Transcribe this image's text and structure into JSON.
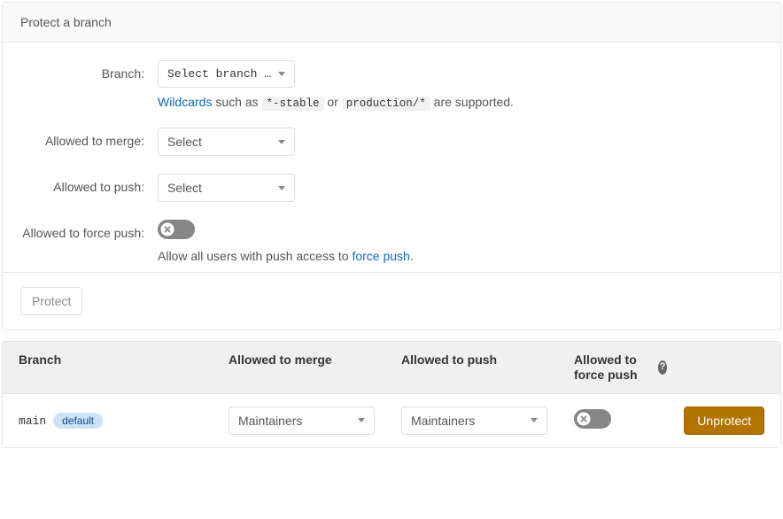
{
  "form": {
    "header": "Protect a branch",
    "rows": {
      "branch": {
        "label": "Branch:",
        "placeholder": "Select branch …",
        "help": {
          "wildcards_link": "Wildcards",
          "text_such_as": "such as",
          "code1": "*-stable",
          "text_or": "or",
          "code2": "production/*",
          "text_supported": "are supported."
        }
      },
      "allowed_to_merge": {
        "label": "Allowed to merge:",
        "placeholder": "Select"
      },
      "allowed_to_push": {
        "label": "Allowed to push:",
        "placeholder": "Select"
      },
      "allowed_to_force_push": {
        "label": "Allowed to force push:",
        "help_prefix": "Allow all users with push access to ",
        "help_link": "force push",
        "help_suffix": "."
      }
    },
    "submit_button": "Protect"
  },
  "table": {
    "headers": {
      "branch": "Branch",
      "merge": "Allowed to merge",
      "push": "Allowed to push",
      "force": "Allowed to force push",
      "help_icon": "?"
    },
    "rows": [
      {
        "name": "main",
        "badge": "default",
        "merge_value": "Maintainers",
        "push_value": "Maintainers",
        "force_push": false,
        "action": "Unprotect"
      }
    ]
  }
}
